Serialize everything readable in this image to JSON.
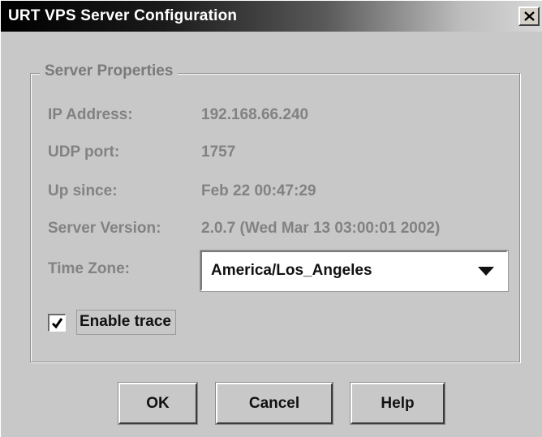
{
  "window": {
    "title": "URT VPS Server Configuration",
    "close_icon": "close-x-icon"
  },
  "group": {
    "title": "Server Properties"
  },
  "properties": {
    "ip_label": "IP Address:",
    "ip_value": "192.168.66.240",
    "udp_label": "UDP port:",
    "udp_value": "1757",
    "up_label": "Up since:",
    "up_value": "Feb 22 00:47:29",
    "version_label": "Server Version:",
    "version_value": "2.0.7 (Wed Mar 13 03:00:01 2002)",
    "tz_label": "Time Zone:",
    "tz_value": "America/Los_Angeles",
    "tz_arrow_icon": "dropdown-arrow-icon"
  },
  "trace": {
    "label": "Enable trace",
    "checked": true,
    "check_icon": "checkmark-icon"
  },
  "buttons": {
    "ok": "OK",
    "cancel": "Cancel",
    "help": "Help"
  },
  "colors": {
    "dialog_bg": "#c8c8c8",
    "disabled_text": "#828282",
    "titlebar_start": "#000000",
    "titlebar_end": "#d8d8d8"
  }
}
